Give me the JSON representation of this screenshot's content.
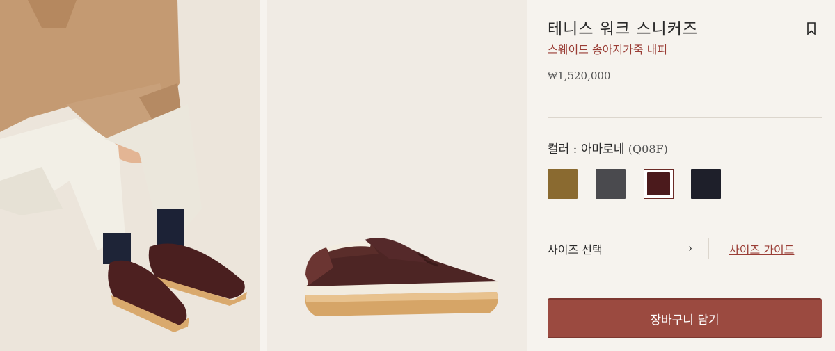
{
  "product": {
    "title": "테니스 워크 스니커즈",
    "subtitle": "스웨이드 송아지가죽 내피",
    "price": "₩1,520,000"
  },
  "images": {
    "model_photo": "model-wearing-sneakers",
    "product_photo": "sneaker-side-view"
  },
  "color": {
    "label": "컬러 : 아마로네",
    "code": "(Q08F)",
    "selected_index": 2,
    "swatches": [
      {
        "name": "olive-brown",
        "hex": "#8a6a30"
      },
      {
        "name": "grey",
        "hex": "#4a4a4e"
      },
      {
        "name": "amarone",
        "hex": "#4b1a1c"
      },
      {
        "name": "navy",
        "hex": "#1e1f2a"
      }
    ]
  },
  "size": {
    "select_label": "사이즈 선택",
    "chevron": "›",
    "guide_label": "사이즈 가이드"
  },
  "cta": {
    "add_to_cart": "장바구니 담기",
    "color": "#9b4a40"
  },
  "accent": "#9a3d35"
}
